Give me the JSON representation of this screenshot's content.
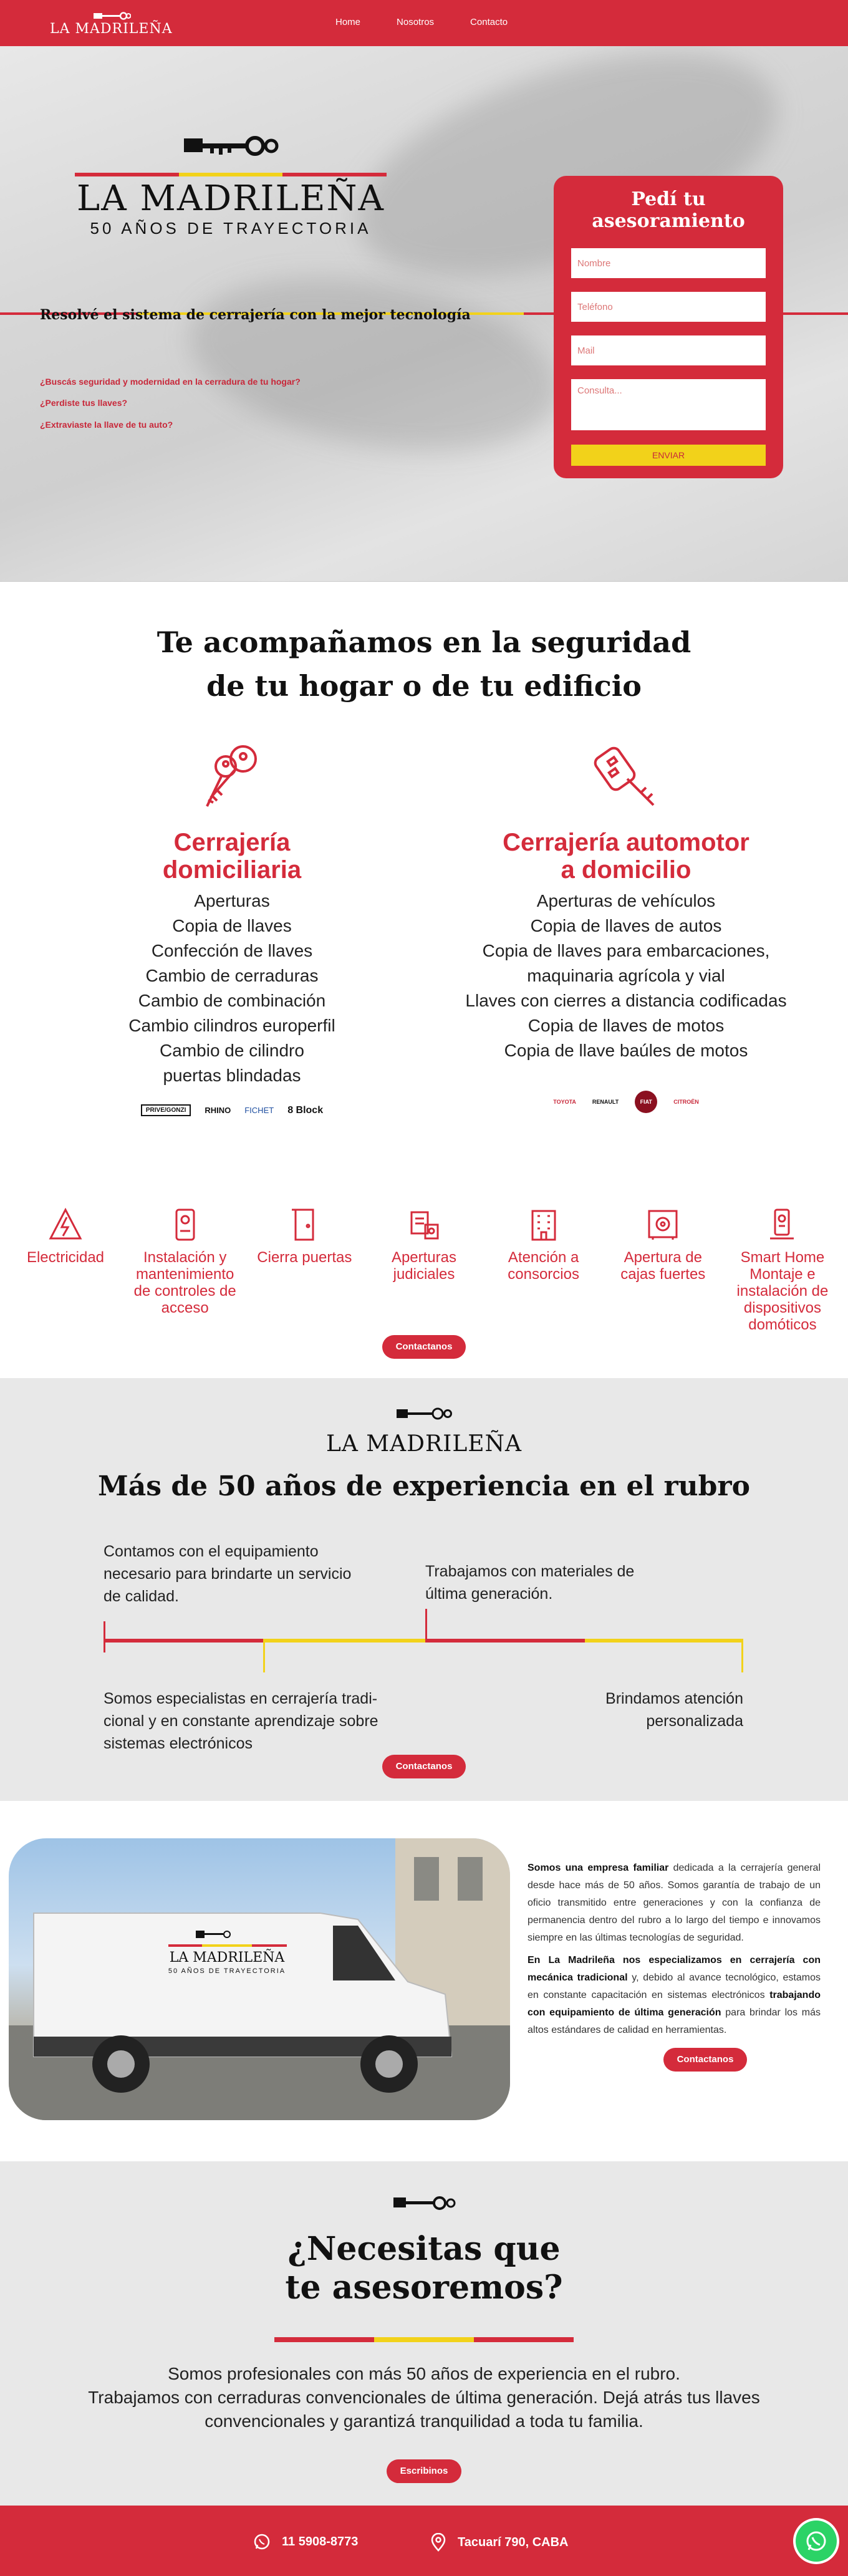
{
  "nav": {
    "logo": "LA MADRILEÑA",
    "links": [
      "Home",
      "Nosotros",
      "Contacto"
    ]
  },
  "hero": {
    "logo_name": "LA MADRILEÑA",
    "logo_sub": "50 AÑOS DE TRAYECTORIA",
    "tagline": "Resolvé el sistema de cerrajería con la mejor tecnología",
    "questions": [
      "¿Buscás seguridad y modernidad en la cerradura de tu hogar?",
      "¿Perdiste tus llaves?",
      "¿Extraviaste la llave de tu auto?"
    ],
    "form": {
      "title": "Pedí tu asesoramiento",
      "name_placeholder": "Nombre",
      "phone_placeholder": "Teléfono",
      "mail_placeholder": "Mail",
      "message_placeholder": "Consulta...",
      "send_label": "ENVIAR"
    }
  },
  "services": {
    "title_line1": "Te acompañamos en la seguridad",
    "title_line2": "de tu hogar o de tu edificio",
    "home": {
      "title_line1": "Cerrajería",
      "title_line2": "domiciliaria",
      "items": [
        "Aperturas",
        "Copia de llaves",
        "Confección de llaves",
        "Cambio de cerraduras",
        "Cambio de combinación",
        "Cambio cilindros europerfil",
        "Cambio de cilindro",
        "puertas blindadas"
      ],
      "brands": [
        "PRIVE/GONZI",
        "RHINO",
        "FICHET",
        "8 Block"
      ]
    },
    "auto": {
      "title_line1": "Cerrajería automotor",
      "title_line2": "a domicilio",
      "items": [
        "Aperturas de vehículos",
        "Copia de llaves de autos",
        "Copia de llaves para embarcaciones,",
        "maquinaria agrícola y vial",
        "Llaves con cierres a distancia codificadas",
        "Copia de llaves de motos",
        "Copia de llave baúles de motos"
      ],
      "brands": [
        "TOYOTA",
        "RENAULT",
        "FIAT",
        "CITROËN"
      ]
    },
    "extras": [
      {
        "label": "Electricidad",
        "icon": "electricity-icon"
      },
      {
        "label": "Instalación y mantenimiento de controles de acceso",
        "icon": "access-control-icon"
      },
      {
        "label": "Cierra puertas",
        "icon": "door-closer-icon"
      },
      {
        "label": "Aperturas judiciales",
        "icon": "judicial-icon"
      },
      {
        "label": "Atención a consorcios",
        "icon": "building-icon"
      },
      {
        "label": "Apertura de cajas fuertes",
        "icon": "safe-icon"
      },
      {
        "label": "Smart Home Montaje e instalación de dispositivos domóticos",
        "icon": "smart-home-icon"
      }
    ],
    "cta": "Contactanos"
  },
  "experience": {
    "logo": "LA MADRILEÑA",
    "title": "Más de 50 años de experiencia en el rubro",
    "p1": "Contamos con el equipamiento necesario para brindarte un servicio de calidad.",
    "p2": "Trabajamos con materiales de última generación.",
    "p3": "Somos especialistas en cerrajería tradi- cional y en constante aprendizaje sobre sistemas electrónicos",
    "p4": "Brindamos atención personalizada",
    "cta": "Contactanos"
  },
  "about": {
    "van_logo": "LA MADRILEÑA",
    "van_sub": "50 AÑOS DE TRAYECTORIA",
    "p1_bold": "Somos una empresa familiar",
    "p1_rest": " dedicada a la cerrajería general desde hace más de 50 años. Somos garantía de trabajo de un oficio transmitido entre generaciones y con la confianza de permanencia dentro del rubro a lo largo del tiempo e innovamos siempre en las últimas tecnologías de seguridad.",
    "p2_bold": "En La Madrileña nos especializamos en cerrajería con mecánica tradicional",
    "p2_mid": " y, debido al avance tecnológico, estamos en constante capacitación en sistemas electrónicos ",
    "p2_bold2": "trabajando con equipamiento de última generación",
    "p2_end": " para brindar los más altos estándares de calidad en herramientas.",
    "cta": "Contactanos"
  },
  "cta_section": {
    "title_line1": "¿Necesitas que",
    "title_line2": "te asesoremos?",
    "body_line1": "Somos profesionales con más 50 años de experiencia en el rubro.",
    "body_line2": "Trabajamos con cerraduras convencionales de última generación. Dejá atrás tus llaves",
    "body_line3": "convencionales y garantizá tranquilidad a toda tu familia.",
    "cta": "Escribinos"
  },
  "footer": {
    "phone": "11 5908-8773",
    "address": "Tacuarí 790, CABA"
  },
  "colors": {
    "brand_red": "#d42b3b",
    "brand_yellow": "#f2d21a",
    "whatsapp_green": "#2bd366"
  }
}
